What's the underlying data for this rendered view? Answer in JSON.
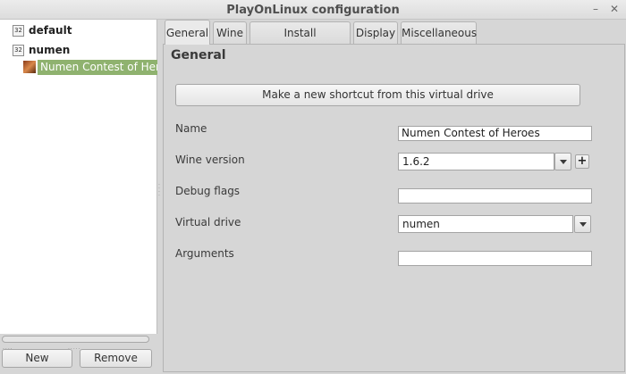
{
  "window": {
    "title": "PlayOnLinux configuration",
    "minimize_glyph": "–",
    "close_glyph": "✕"
  },
  "sidebar": {
    "nodes": [
      {
        "icon_text": "32",
        "label": "default"
      },
      {
        "icon_text": "32",
        "label": "numen"
      }
    ],
    "selected_child": {
      "label": "Numen Contest of Heroes"
    },
    "grip_text": "....",
    "grip_text_center": ".....",
    "new_label": "New",
    "remove_label": "Remove"
  },
  "splitter": {
    "grip_text": "·\n·\n·"
  },
  "tabs": [
    {
      "label": "General",
      "active": true
    },
    {
      "label": "Wine",
      "active": false
    },
    {
      "label": "Install components",
      "active": false
    },
    {
      "label": "Display",
      "active": false
    },
    {
      "label": "Miscellaneous",
      "active": false
    }
  ],
  "general": {
    "heading": "General",
    "shortcut_button": "Make a new shortcut from this virtual drive",
    "name_label": "Name",
    "name_value": "Numen Contest of Heroes",
    "wine_version_label": "Wine version",
    "wine_version_value": "1.6.2",
    "add_version_glyph": "+",
    "debug_flags_label": "Debug flags",
    "debug_flags_value": "",
    "virtual_drive_label": "Virtual drive",
    "virtual_drive_value": "numen",
    "arguments_label": "Arguments",
    "arguments_value": ""
  },
  "colors": {
    "selection": "#8fb26f",
    "window_bg": "#d6d6d6"
  }
}
